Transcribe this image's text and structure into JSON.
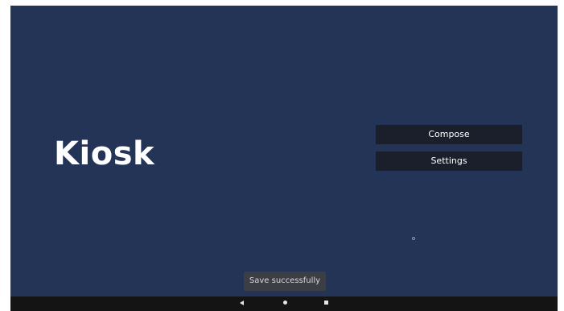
{
  "app": {
    "title": "Kiosk"
  },
  "menu": {
    "compose_label": "Compose",
    "settings_label": "Settings"
  },
  "toast": {
    "message": "Save successfully"
  },
  "nav": {
    "back_icon": "back-icon",
    "home_icon": "home-icon",
    "recents_icon": "recents-icon"
  },
  "colors": {
    "background": "#233457",
    "button": "#1b1f2c",
    "navbar": "#141414",
    "toast": "#3b3e44"
  }
}
